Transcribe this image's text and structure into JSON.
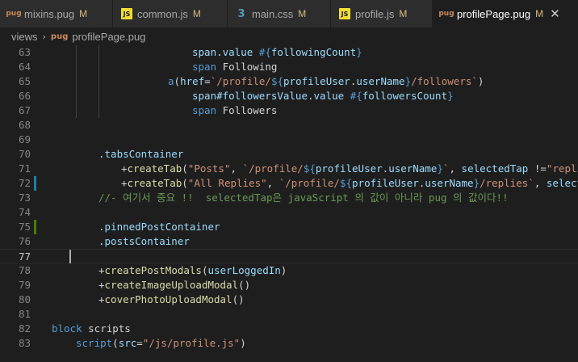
{
  "tabs": [
    {
      "icon": "pug-icon",
      "icon_glyph": "pug",
      "name": "mixins.pug",
      "status": "M"
    },
    {
      "icon": "js-icon",
      "icon_glyph": "JS",
      "name": "common.js",
      "status": "M"
    },
    {
      "icon": "css-icon",
      "icon_glyph": "3",
      "name": "main.css",
      "status": "M"
    },
    {
      "icon": "js-icon",
      "icon_glyph": "JS",
      "name": "profile.js",
      "status": "M"
    },
    {
      "icon": "pug-icon",
      "icon_glyph": "pug",
      "name": "profilePage.pug",
      "status": "M",
      "close": "✕"
    }
  ],
  "breadcrumb": {
    "folder": "views",
    "separator": "›",
    "file": "profilePage.pug"
  },
  "lines": [
    {
      "n": "63",
      "tokens": [
        [
          "t-class",
          "span.value "
        ],
        [
          "t-interp",
          "#{"
        ],
        [
          "t-var",
          "followingCount"
        ],
        [
          "t-interp",
          "}"
        ]
      ]
    },
    {
      "n": "64",
      "tokens": [
        [
          "t-tag",
          "span "
        ],
        [
          "t-text",
          "Following"
        ]
      ]
    },
    {
      "n": "65",
      "tokens": [
        [
          "t-tag",
          "a"
        ],
        [
          "t-plain",
          "("
        ],
        [
          "t-attr",
          "href"
        ],
        [
          "t-plain",
          "="
        ],
        [
          "t-str",
          "`/profile/"
        ],
        [
          "t-interp",
          "${"
        ],
        [
          "t-var",
          "profileUser"
        ],
        [
          "t-plain",
          "."
        ],
        [
          "t-var",
          "userName"
        ],
        [
          "t-interp",
          "}"
        ],
        [
          "t-str",
          "/followers`"
        ],
        [
          "t-plain",
          ")"
        ]
      ]
    },
    {
      "n": "66",
      "tokens": [
        [
          "t-class",
          "span#followersValue.value "
        ],
        [
          "t-interp",
          "#{"
        ],
        [
          "t-var",
          "followersCount"
        ],
        [
          "t-interp",
          "}"
        ]
      ]
    },
    {
      "n": "67",
      "tokens": [
        [
          "t-tag",
          "span "
        ],
        [
          "t-text",
          "Followers"
        ]
      ]
    },
    {
      "n": "68",
      "tokens": []
    },
    {
      "n": "69",
      "tokens": []
    },
    {
      "n": "70",
      "tokens": [
        [
          "t-class",
          ".tabsContainer"
        ]
      ]
    },
    {
      "n": "71",
      "tokens": [
        [
          "t-op",
          "+"
        ],
        [
          "t-mixin",
          "createTab"
        ],
        [
          "t-plain",
          "("
        ],
        [
          "t-str",
          "\"Posts\""
        ],
        [
          "t-plain",
          ", "
        ],
        [
          "t-str",
          "`/profile/"
        ],
        [
          "t-interp",
          "${"
        ],
        [
          "t-var",
          "profileUser"
        ],
        [
          "t-plain",
          "."
        ],
        [
          "t-var",
          "userName"
        ],
        [
          "t-interp",
          "}"
        ],
        [
          "t-str",
          "`"
        ],
        [
          "t-plain",
          ", "
        ],
        [
          "t-var",
          "selectedTap "
        ],
        [
          "t-plain",
          "!="
        ],
        [
          "t-str",
          "\"replies\""
        ]
      ]
    },
    {
      "n": "72",
      "tokens": [
        [
          "t-op",
          "+"
        ],
        [
          "t-mixin",
          "createTab"
        ],
        [
          "t-plain",
          "("
        ],
        [
          "t-str",
          "\"All Replies\""
        ],
        [
          "t-plain",
          ", "
        ],
        [
          "t-str",
          "`/profile/"
        ],
        [
          "t-interp",
          "${"
        ],
        [
          "t-var",
          "profileUser"
        ],
        [
          "t-plain",
          "."
        ],
        [
          "t-var",
          "userName"
        ],
        [
          "t-interp",
          "}"
        ],
        [
          "t-str",
          "/replies`"
        ],
        [
          "t-plain",
          ", "
        ],
        [
          "t-var",
          "selectedTa"
        ]
      ]
    },
    {
      "n": "73",
      "tokens": [
        [
          "t-comment",
          "//- 여기서 중요 !!  selectedTap은 javaScript 의 값이 아니라 pug 의 값이다!!"
        ]
      ]
    },
    {
      "n": "74",
      "tokens": []
    },
    {
      "n": "75",
      "tokens": [
        [
          "t-class",
          ".pinnedPostContainer"
        ]
      ]
    },
    {
      "n": "76",
      "tokens": [
        [
          "t-class",
          ".postsContainer"
        ]
      ]
    },
    {
      "n": "77",
      "tokens": []
    },
    {
      "n": "78",
      "tokens": [
        [
          "t-op",
          "+"
        ],
        [
          "t-mixin",
          "createPostModals"
        ],
        [
          "t-plain",
          "("
        ],
        [
          "t-var",
          "userLoggedIn"
        ],
        [
          "t-plain",
          ")"
        ]
      ]
    },
    {
      "n": "79",
      "tokens": [
        [
          "t-op",
          "+"
        ],
        [
          "t-mixin",
          "createImageUploadModal"
        ],
        [
          "t-plain",
          "()"
        ]
      ]
    },
    {
      "n": "80",
      "tokens": [
        [
          "t-op",
          "+"
        ],
        [
          "t-mixin",
          "coverPhotoUploadModal"
        ],
        [
          "t-plain",
          "()"
        ]
      ]
    },
    {
      "n": "81",
      "tokens": []
    },
    {
      "n": "82",
      "tokens": [
        [
          "t-tag",
          "block "
        ],
        [
          "t-text",
          "scripts"
        ]
      ]
    },
    {
      "n": "83",
      "tokens": [
        [
          "t-tag",
          "script"
        ],
        [
          "t-plain",
          "("
        ],
        [
          "t-attr",
          "src"
        ],
        [
          "t-plain",
          "="
        ],
        [
          "t-str",
          "\"/js/profile.js\""
        ],
        [
          "t-plain",
          ")"
        ]
      ]
    }
  ]
}
